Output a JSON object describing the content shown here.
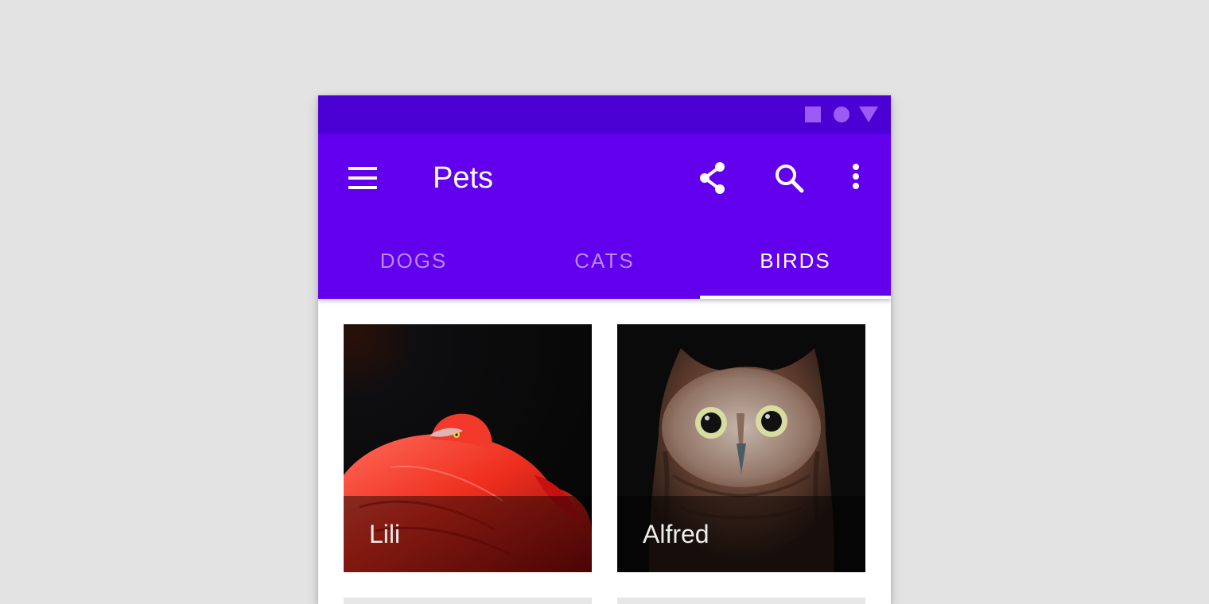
{
  "app": {
    "title": "Pets",
    "primary_color": "#6200ee",
    "status_bar_color": "#4b01d4"
  },
  "status_bar": {
    "icons": [
      "square-icon",
      "circle-icon",
      "triangle-icon"
    ]
  },
  "toolbar": {
    "navigation_icon": "menu-icon",
    "actions": [
      "share-icon",
      "search-icon",
      "more-vert-icon"
    ]
  },
  "tabs": [
    {
      "label": "DOGS",
      "selected": false
    },
    {
      "label": "CATS",
      "selected": false
    },
    {
      "label": "BIRDS",
      "selected": true
    }
  ],
  "grid": {
    "items": [
      {
        "name": "Lili",
        "image": "flamingo"
      },
      {
        "name": "Alfred",
        "image": "owl"
      }
    ]
  }
}
